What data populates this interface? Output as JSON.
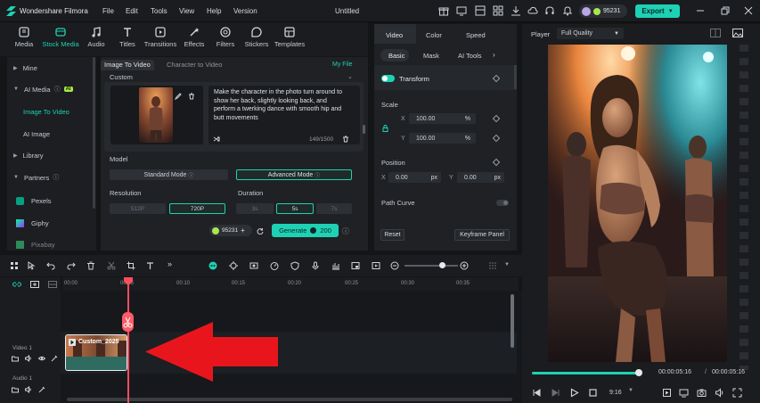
{
  "app": {
    "name": "Wondershare Filmora",
    "doc_title": "Untitled",
    "credits": "95231",
    "export_label": "Export"
  },
  "menu": [
    "File",
    "Edit",
    "Tools",
    "View",
    "Help",
    "Version"
  ],
  "media_toolbar": [
    {
      "label": "Media",
      "icon": "media-icon"
    },
    {
      "label": "Stock Media",
      "icon": "stock-media-icon",
      "active": true
    },
    {
      "label": "Audio",
      "icon": "audio-icon"
    },
    {
      "label": "Titles",
      "icon": "titles-icon"
    },
    {
      "label": "Transitions",
      "icon": "transitions-icon"
    },
    {
      "label": "Effects",
      "icon": "effects-icon"
    },
    {
      "label": "Filters",
      "icon": "filters-icon"
    },
    {
      "label": "Stickers",
      "icon": "stickers-icon"
    },
    {
      "label": "Templates",
      "icon": "templates-icon"
    }
  ],
  "sidebar": {
    "mine": "Mine",
    "ai_media": "AI Media",
    "ai_badge": "AI",
    "image_to_video": "Image To Video",
    "ai_image": "AI Image",
    "library": "Library",
    "partners": "Partners",
    "pexels": "Pexels",
    "giphy": "Giphy",
    "pixabay": "Pixabay"
  },
  "ai_panel": {
    "tab_image_to_video": "Image To Video",
    "tab_character_to_video": "Character to Video",
    "my_file": "My File",
    "custom": "Custom",
    "prompt": "Make the character in the photo turn around to show her back, slightly looking back, and perform a  twerking dance with smooth hip and butt movements",
    "char_count": "149/1500",
    "model_label": "Model",
    "standard_mode": "Standard Mode",
    "advanced_mode": "Advanced Mode",
    "resolution_label": "Resolution",
    "res_options": [
      "512P",
      "720P"
    ],
    "duration_label": "Duration",
    "dur_options": [
      "3s",
      "5s",
      "7s"
    ],
    "credits_chip": "95231",
    "generate_label": "Generate",
    "generate_cost": "200"
  },
  "props": {
    "tabs": [
      "Video",
      "Color",
      "Speed"
    ],
    "subtabs": [
      "Basic",
      "Mask",
      "AI Tools"
    ],
    "transform": "Transform",
    "scale": "Scale",
    "scale_x": "100.00",
    "scale_y": "100.00",
    "pct": "%",
    "x_lbl": "X",
    "y_lbl": "Y",
    "position": "Position",
    "pos_x": "0.00",
    "pos_y": "0.00",
    "px": "px",
    "path_curve": "Path Curve",
    "reset": "Reset",
    "keyframe_panel": "Keyframe Panel"
  },
  "player": {
    "label": "Player",
    "quality": "Full Quality",
    "current_time": "00:00:05:16",
    "separator": "/",
    "total_time": "00:00:05:16",
    "aspect": "9:16",
    "progress": 1.0
  },
  "timeline": {
    "ticks": [
      "00:00",
      "00:05",
      "00:10",
      "00:15",
      "00:20",
      "00:25",
      "00:30",
      "00:35"
    ],
    "video_track": "Video 1",
    "audio_track": "Audio 1",
    "clip_label": "Custom_2025",
    "zoom": 0.7
  },
  "colors": {
    "accent": "#1ed1b4",
    "playhead": "#ff4d5e",
    "arrow": "#e8161c"
  }
}
